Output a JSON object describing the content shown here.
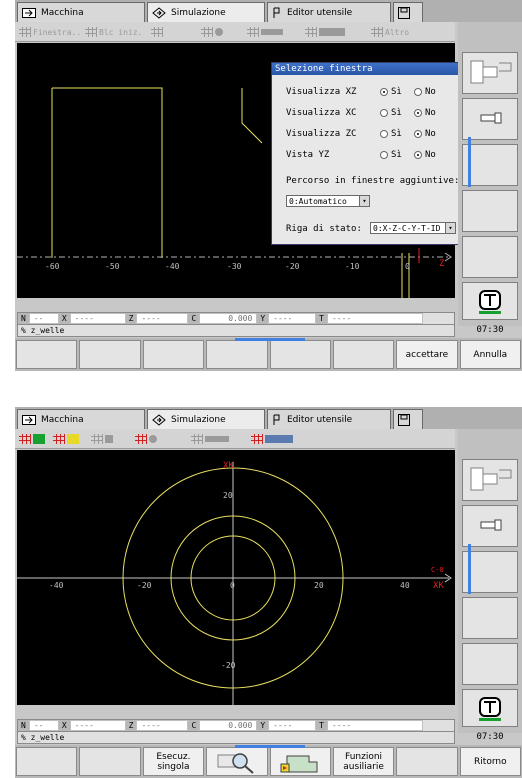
{
  "screen1": {
    "tabs": {
      "machine": "Macchina",
      "simulation": "Simulazione",
      "tool_editor": "Editor utensile"
    },
    "toolbar": {
      "window": "Finestra..",
      "block_start": "Blc iniz.",
      "other": "Altro"
    },
    "axis_labels": [
      "-60",
      "-50",
      "-40",
      "-30",
      "-20",
      "-10",
      "0"
    ],
    "axis_z": "Z",
    "dialog": {
      "title": "Selezione finestra",
      "rows": [
        {
          "label": "Visualizza XZ",
          "yes": "Sì",
          "no": "No",
          "selected": "yes"
        },
        {
          "label": "Visualizza XC",
          "yes": "Sì",
          "no": "No",
          "selected": "no"
        },
        {
          "label": "Visualizza ZC",
          "yes": "Sì",
          "no": "No",
          "selected": "no"
        },
        {
          "label": "Vista YZ",
          "yes": "Sì",
          "no": "No",
          "selected": "no"
        }
      ],
      "path_label": "Percorso in finestre aggiuntive:",
      "path_value": "0:Automatico",
      "status_label": "Riga di stato:",
      "status_value": "0:X-Z-C-Y-T-ID"
    },
    "status": {
      "n_label": "N",
      "n_value": "--",
      "x_label": "X",
      "x_value": "----",
      "z_label": "Z",
      "z_value": "----",
      "c_label": "C",
      "c_value": "0.000",
      "y_label": "Y",
      "y_value": "----",
      "t_label": "T",
      "t_value": "----",
      "program": "% z_welle"
    },
    "time": "07:30",
    "softkeys": {
      "accept": "accettare",
      "cancel": "Annulla"
    }
  },
  "screen2": {
    "tabs": {
      "machine": "Macchina",
      "simulation": "Simulazione",
      "tool_editor": "Editor utensile"
    },
    "axis_labels_x": [
      "-40",
      "-20",
      "0",
      "20",
      "40"
    ],
    "axis_labels_y": [
      "20",
      "-20"
    ],
    "axis_top": "XK",
    "axis_right_top": "C-0",
    "axis_right": "XK",
    "status": {
      "n_label": "N",
      "n_value": "--",
      "x_label": "X",
      "x_value": "----",
      "z_label": "Z",
      "z_value": "----",
      "c_label": "C",
      "c_value": "0.000",
      "y_label": "Y",
      "y_value": "----",
      "t_label": "T",
      "t_value": "----",
      "program": "% z_welle"
    },
    "time": "07:30",
    "softkeys": {
      "single_exec": "Esecuz.\nsingola",
      "aux_functions": "Funzioni\nausiliarie",
      "back": "Ritorno"
    }
  },
  "colors": {
    "accent_blue": "#2a55a8",
    "contour_yellow": "#e8e060",
    "axis_red": "#e02020"
  }
}
